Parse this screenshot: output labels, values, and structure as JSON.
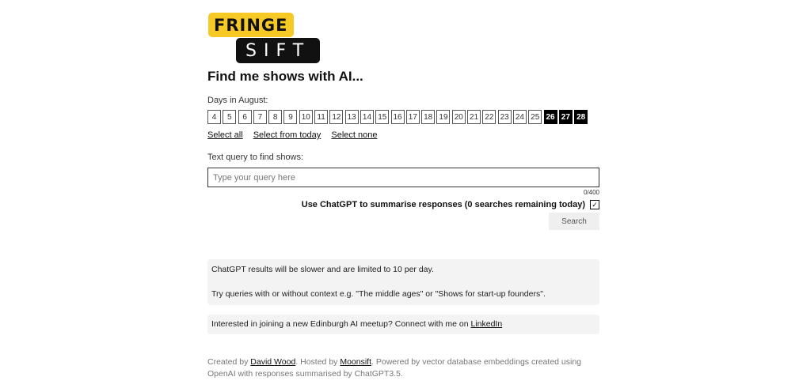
{
  "logo": {
    "top": "FRINGE",
    "bottom": "SIFT"
  },
  "heading": "Find me shows with AI...",
  "days_label": "Days in August:",
  "days": [
    {
      "label": "4",
      "selected": false
    },
    {
      "label": "5",
      "selected": false
    },
    {
      "label": "6",
      "selected": false
    },
    {
      "label": "7",
      "selected": false
    },
    {
      "label": "8",
      "selected": false
    },
    {
      "label": "9",
      "selected": false
    },
    {
      "label": "10",
      "selected": false
    },
    {
      "label": "11",
      "selected": false
    },
    {
      "label": "12",
      "selected": false
    },
    {
      "label": "13",
      "selected": false
    },
    {
      "label": "14",
      "selected": false
    },
    {
      "label": "15",
      "selected": false
    },
    {
      "label": "16",
      "selected": false
    },
    {
      "label": "17",
      "selected": false
    },
    {
      "label": "18",
      "selected": false
    },
    {
      "label": "19",
      "selected": false
    },
    {
      "label": "20",
      "selected": false
    },
    {
      "label": "21",
      "selected": false
    },
    {
      "label": "22",
      "selected": false
    },
    {
      "label": "23",
      "selected": false
    },
    {
      "label": "24",
      "selected": false
    },
    {
      "label": "25",
      "selected": false
    },
    {
      "label": "26",
      "selected": true
    },
    {
      "label": "27",
      "selected": true
    },
    {
      "label": "28",
      "selected": true
    }
  ],
  "select_links": {
    "all": "Select all",
    "from_today": "Select from today",
    "none": "Select none"
  },
  "query": {
    "label": "Text query to find shows:",
    "placeholder": "Type your query here",
    "value": "",
    "counter": "0/400"
  },
  "gpt": {
    "label": "Use ChatGPT to summarise responses (0 searches remaining today)",
    "checked": true,
    "check_glyph": "✓"
  },
  "search_button": "Search",
  "info": {
    "line1": "ChatGPT results will be slower and are limited to 10 per day.",
    "line2": "Try queries with or without context e.g. \"The middle ages\" or \"Shows for start-up founders\".",
    "meetup_text": "Interested in joining a new Edinburgh AI meetup? Connect with me on ",
    "meetup_link": "LinkedIn"
  },
  "footer": {
    "created_by": "Created by ",
    "author": "David Wood",
    "hosted_by": ". Hosted by ",
    "host": "Moonsift",
    "rest": ". Powered by vector database embeddings created using OpenAI with responses summarised by ChatGPT3.5."
  }
}
